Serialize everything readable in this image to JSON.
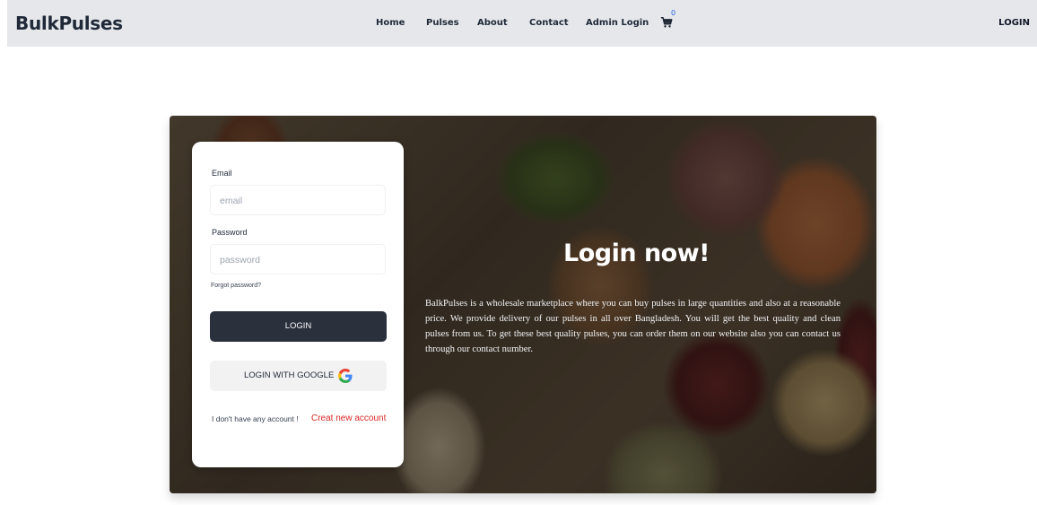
{
  "nav": {
    "brand": "BulkPulses",
    "links": [
      "Home",
      "Pulses",
      "About",
      "Contact",
      "Admin Login"
    ],
    "cart_count": "0",
    "login_label": "LOGIN"
  },
  "hero": {
    "title": "Login now!",
    "description": "BalkPulses is a wholesale marketplace where you can buy pulses in large quantities and also at a reasonable price. We provide delivery of our pulses in all over Bangladesh. You will get the best quality and clean pulses from us. To get these best quality pulses, you can order them on our website also you can contact us through our contact number."
  },
  "form": {
    "email_label": "Email",
    "email_placeholder": "email",
    "password_label": "Password",
    "password_placeholder": "password",
    "forgot_label": "Forgot password?",
    "login_button": "LOGIN",
    "google_button": "LOGIN WITH GOOGLE",
    "no_account_text": "I don't have any account !",
    "create_account_link": "Creat new account"
  },
  "colors": {
    "navbar_bg": "#e5e7eb",
    "login_button_bg": "#2a303c",
    "create_link": "#dc2626",
    "cart_badge": "#2563eb"
  },
  "icons": {
    "cart": "shopping-cart-icon",
    "google": "google-icon"
  }
}
